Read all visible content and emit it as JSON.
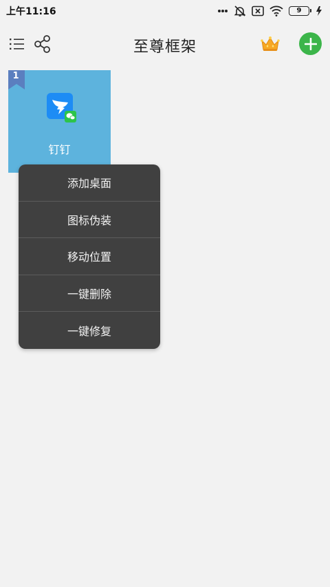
{
  "status_bar": {
    "time": "上午11:16",
    "icons": [
      "more-dots-icon",
      "alarm-off-icon",
      "sim-card-x-icon",
      "wifi-icon",
      "battery-icon",
      "charging-icon"
    ],
    "battery_level": "9"
  },
  "toolbar": {
    "title": "至尊框架",
    "icons": [
      "list-menu-icon",
      "share-icon",
      "crown-icon",
      "plus-icon"
    ]
  },
  "app_tile": {
    "badge_number": "1",
    "label": "钉钉",
    "icon": "dingtalk-app-icon",
    "tile_color": "#5db3dd"
  },
  "context_menu": {
    "items": [
      {
        "label": "添加桌面"
      },
      {
        "label": "图标伪装"
      },
      {
        "label": "移动位置"
      },
      {
        "label": "一键删除"
      },
      {
        "label": "一键修复"
      }
    ]
  },
  "colors": {
    "accent_green": "#3cb54a",
    "menu_bg": "#404040",
    "badge": "#5b7fbf"
  }
}
